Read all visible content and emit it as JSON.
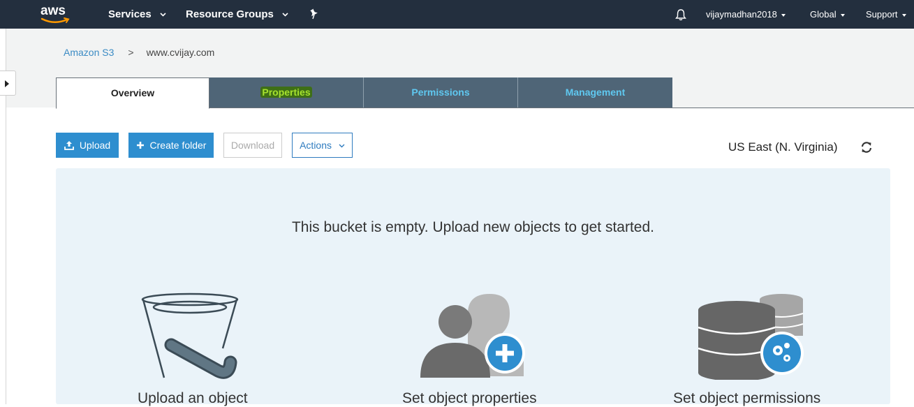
{
  "topnav": {
    "logo": "aws",
    "services": "Services",
    "resource_groups": "Resource Groups",
    "pin_icon": "pin-icon",
    "bell_icon": "bell-icon",
    "user": "vijaymadhan2018",
    "region_menu": "Global",
    "support": "Support"
  },
  "breadcrumb": {
    "root": "Amazon S3",
    "separator": ">",
    "current": "www.cvijay.com"
  },
  "tabs": [
    {
      "label": "Overview",
      "active": true
    },
    {
      "label": "Properties",
      "active": false,
      "highlighted": true
    },
    {
      "label": "Permissions",
      "active": false
    },
    {
      "label": "Management",
      "active": false
    }
  ],
  "toolbar": {
    "upload": "Upload",
    "create_folder": "Create folder",
    "download": "Download",
    "actions": "Actions",
    "region": "US East (N. Virginia)"
  },
  "empty_state": {
    "message": "This bucket is empty. Upload new objects to get started.",
    "cards": [
      {
        "label": "Upload an object",
        "icon": "bucket-icon"
      },
      {
        "label": "Set object properties",
        "icon": "user-add-icon"
      },
      {
        "label": "Set object permissions",
        "icon": "database-settings-icon"
      }
    ]
  },
  "colors": {
    "nav_bg": "#232f3e",
    "primary": "#2e8ecf",
    "tab_inactive_bg": "#4f6577",
    "tab_inactive_text": "#5fc8f0",
    "highlight_text": "#a6e22e"
  }
}
